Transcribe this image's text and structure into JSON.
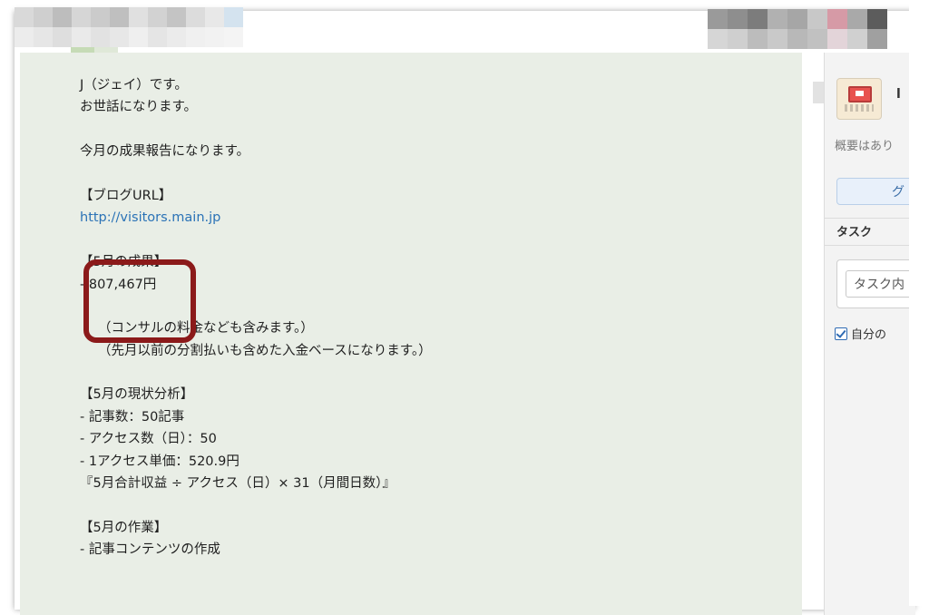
{
  "header": {
    "pixels_left": [
      "#d9d9d9",
      "#cfcfcf",
      "#bdbdbd",
      "#d6d6d6",
      "#cbcbcb",
      "#bfbfbf",
      "#e0e0e0",
      "#d2d2d2",
      "#c4c4c4",
      "#dcdcdc",
      "#e8e8e8",
      "#d4e3ef"
    ],
    "pixels_left2": [
      "#ececec",
      "#e6e6e6",
      "#dedede",
      "#eaeaea",
      "#e2e2e2",
      "#e7e7e7",
      "#efefef",
      "#e5e5e5",
      "#ebebeb",
      "#f0f0f0",
      "#f2f2f2",
      "#f4f4f4"
    ],
    "pixels_left3": [
      "#c6dbb6",
      "#dfe8d8"
    ],
    "pixels_right": [
      "#9a9a9a",
      "#8e8e8e",
      "#7c7c7c",
      "#b1b1b1",
      "#a6a6a6",
      "#c8c8c8",
      "#d69aa6",
      "#a9a9a9",
      "#5c5c5c"
    ],
    "pixels_right2": [
      "#d6d6d6",
      "#cfcfcf",
      "#bcbcbc",
      "#c9c9c9",
      "#b8b8b8",
      "#c1c1c1",
      "#e3d4d9",
      "#d0d0d0",
      "#a0a0a0"
    ]
  },
  "message": {
    "lines": [
      "J（ジェイ）です。",
      "お世話になります。",
      "",
      "今月の成果報告になります。",
      "",
      "【ブログURL】",
      "http://visitors.main.jp",
      "",
      "【5月の成果】",
      "- 807,467円",
      "",
      "（コンサルの料金なども含みます。）",
      "（先月以前の分割払いも含めた入金ベースになります。）",
      "",
      "【5月の現状分析】",
      "- 記事数：50記事",
      "- アクセス数（日）：50",
      "- 1アクセス単価：520.9円",
      "『5月合計収益 ÷ アクセス（日）× 31（月間日数）』",
      "",
      "【5月の作業】",
      "- 記事コンテンツの作成"
    ]
  },
  "side": {
    "avatar_letter": "l",
    "overview": "概要はあり",
    "group_button": "グ",
    "task_title": "タスク",
    "task_input": "タスク内",
    "own_only": "自分の"
  },
  "colors": {
    "chat_bg": "#e9eee6",
    "link": "#2a72b6",
    "highlight": "#8b1a1a"
  }
}
